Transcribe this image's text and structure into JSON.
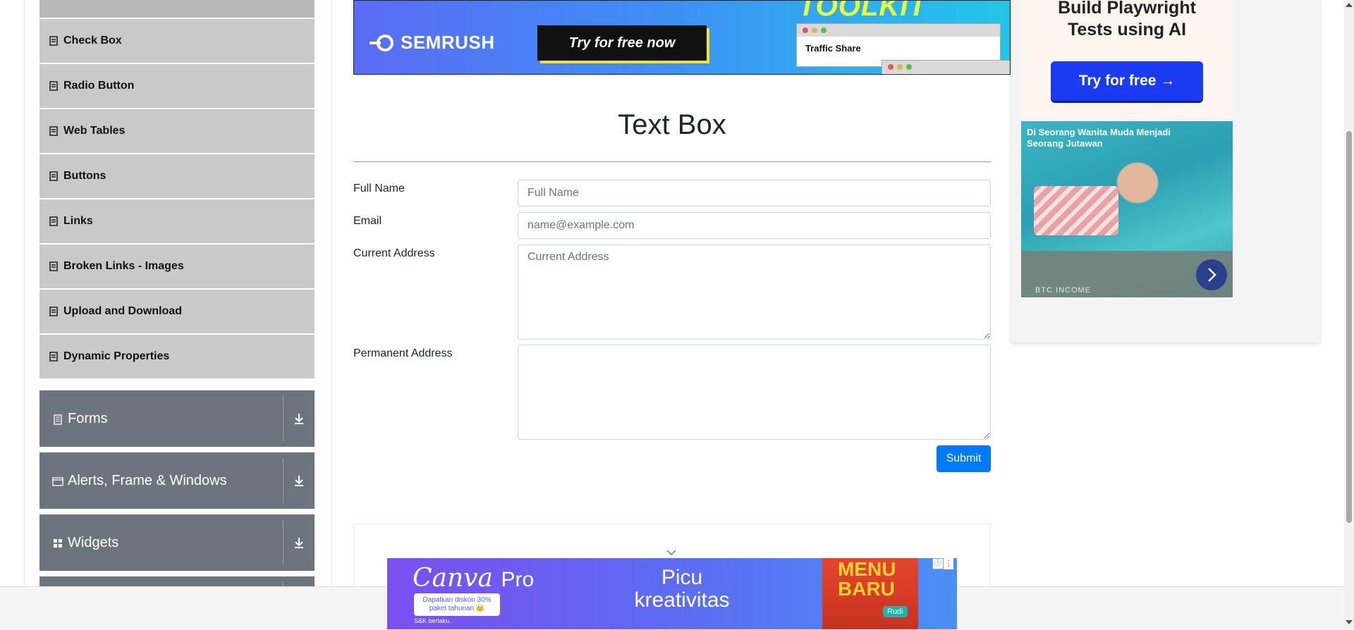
{
  "sidebar": {
    "elements_items": [
      {
        "label": "Check Box"
      },
      {
        "label": "Radio Button"
      },
      {
        "label": "Web Tables"
      },
      {
        "label": "Buttons"
      },
      {
        "label": "Links"
      },
      {
        "label": "Broken Links - Images"
      },
      {
        "label": "Upload and Download"
      },
      {
        "label": "Dynamic Properties"
      }
    ],
    "groups": [
      {
        "label": "Forms",
        "icon": "form-icon"
      },
      {
        "label": "Alerts, Frame & Windows",
        "icon": "window-icon"
      },
      {
        "label": "Widgets",
        "icon": "widgets-icon"
      }
    ]
  },
  "top_ad": {
    "brand": "SEMRUSH",
    "cta": "Try for free now",
    "headline": "TOOLKIT",
    "window_label": "Traffic Share"
  },
  "main": {
    "title": "Text Box",
    "form": {
      "full_name_label": "Full Name",
      "full_name_placeholder": "Full Name",
      "full_name_value": "",
      "email_label": "Email",
      "email_placeholder": "name@example.com",
      "email_value": "",
      "current_address_label": "Current Address",
      "current_address_placeholder": "Current Address",
      "permanent_address_label": "Permanent Address",
      "submit_label": "Submit"
    }
  },
  "right_ad": {
    "title_line1": "Build Playwright",
    "title_line2": "Tests using AI",
    "cta": "Try for free →",
    "caption": "Di Seorang Wanita Muda Menjadi Seorang Jutawan",
    "source": "BTC INCOME"
  },
  "bottom_ad": {
    "brand": "Canva",
    "brand_suffix": "Pro",
    "promo": "Dapatkan diskon 30% paket tahunan 👑",
    "terms": "S&K berlaku.",
    "headline_line1": "Picu",
    "headline_line2": "kreativitas",
    "food_text": "MENU BARU",
    "food_tag": "Rudi",
    "info": "ⓘ",
    "more": "⋮"
  },
  "colors": {
    "group_bg": "#6c757d",
    "item_bg": "#c9c9c9",
    "submit_bg": "#007bff"
  }
}
